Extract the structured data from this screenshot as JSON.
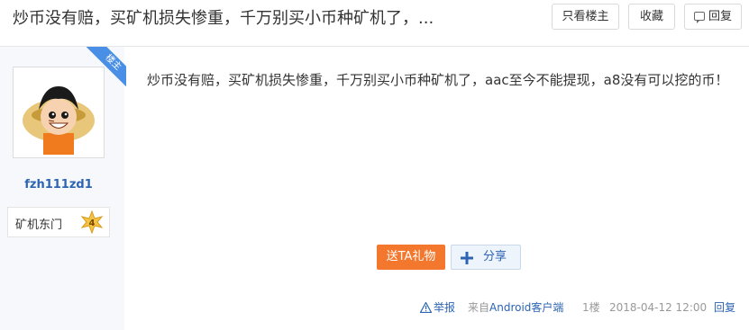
{
  "header": {
    "title": "炒币没有赔，买矿机损失惨重，千万别买小币种矿机了，...",
    "only_op_label": "只看楼主",
    "favorite_label": "收藏",
    "reply_label": "回复",
    "reply_icon": "comment-icon"
  },
  "author": {
    "username": "fzh111zd1",
    "rank_name": "矿机东门",
    "level": "4",
    "op_ribbon": "楼主",
    "avatar_icon": "cartoon-avatar"
  },
  "post": {
    "content": "炒币没有赔，买矿机损失惨重，千万别买小币种矿机了，aac至今不能提现，a8没有可以挖的币！"
  },
  "actions": {
    "gift_label": "送TA礼物",
    "share_label": "分享"
  },
  "footer": {
    "report_label": "举报",
    "source_prefix": "来自",
    "source_app": "Android客户端",
    "floor": "1楼",
    "datetime": "2018-04-12 12:00",
    "reply_label": "回复"
  },
  "colors": {
    "link": "#2d64b3",
    "gift": "#f3772d",
    "ribbon": "#4a8fe6",
    "sidebar_bg": "#f6f8fb"
  }
}
